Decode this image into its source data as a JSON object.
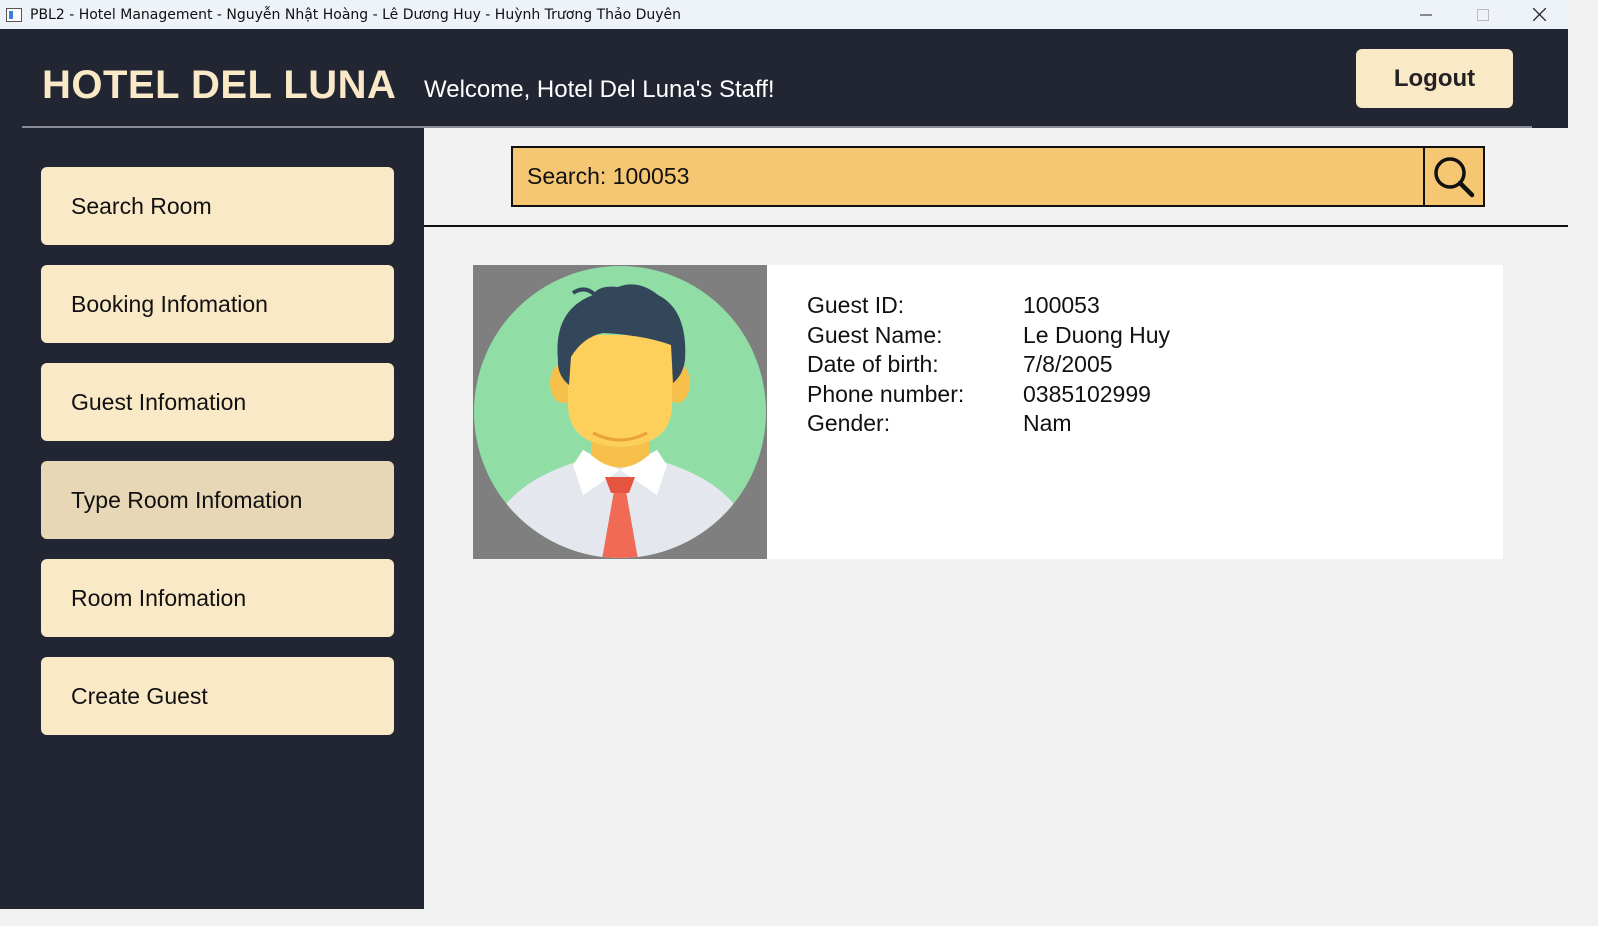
{
  "window": {
    "title": "PBL2 - Hotel Management - Nguyễn Nhật Hoàng - Lê Dương Huy - Huỳnh Trương Thảo Duyên",
    "controls": [
      "minimize-icon",
      "maximize-icon",
      "close-icon"
    ]
  },
  "header": {
    "brand": "HOTEL DEL LUNA",
    "welcome": "Welcome, Hotel Del Luna's Staff!",
    "logout_label": "Logout"
  },
  "sidebar": {
    "items": [
      {
        "label": "Search Room",
        "active": false
      },
      {
        "label": "Booking Infomation",
        "active": false
      },
      {
        "label": "Guest Infomation",
        "active": false
      },
      {
        "label": "Type Room Infomation",
        "active": true
      },
      {
        "label": "Room Infomation",
        "active": false
      },
      {
        "label": "Create Guest",
        "active": false
      }
    ]
  },
  "search": {
    "text": "Search: 100053",
    "icon": "search-icon"
  },
  "guest": {
    "avatar_icon": "user-avatar-icon",
    "fields": [
      {
        "label": "Guest ID:",
        "value": "100053"
      },
      {
        "label": "Guest Name:",
        "value": "Le Duong Huy"
      },
      {
        "label": "Date of birth:",
        "value": "7/8/2005"
      },
      {
        "label": "Phone number:",
        "value": "0385102999"
      },
      {
        "label": "Gender:",
        "value": "Nam"
      }
    ]
  },
  "colors": {
    "dark": "#222632",
    "cream": "#fae9c7",
    "active": "#e8d7b6",
    "search_bg": "#f6c772"
  }
}
